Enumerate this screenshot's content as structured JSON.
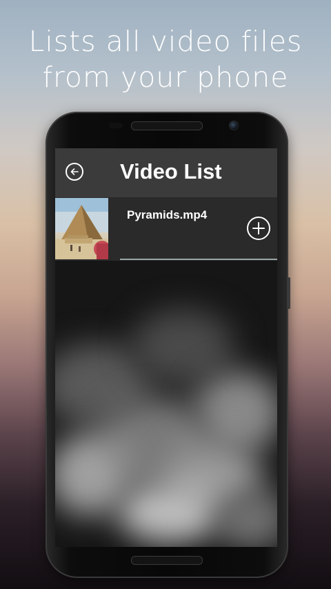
{
  "promo": {
    "line1": "Lists all video files",
    "line2": "from your phone"
  },
  "app": {
    "title": "Video List",
    "back_icon": "back-arrow-icon",
    "items": [
      {
        "name": "Pyramids.mp4",
        "thumbnail": "pyramids-thumbnail",
        "action_icon": "add-circle-icon"
      }
    ]
  },
  "colors": {
    "topbar": "#3b3b3b",
    "list_item": "#2a2a2a",
    "screen_bg": "#1b1b1b",
    "divider": "#9aa4a6"
  }
}
